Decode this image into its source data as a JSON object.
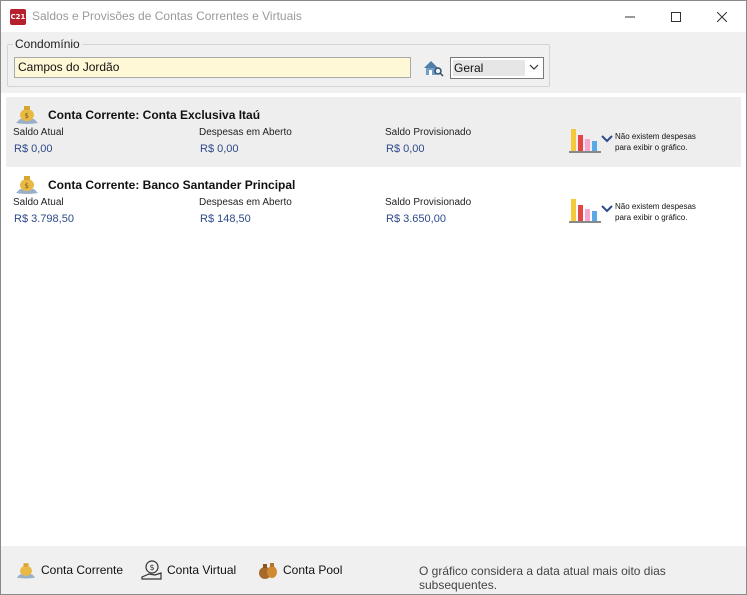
{
  "window": {
    "title": "Saldos e Provisões de Contas Correntes e Virtuais",
    "app_icon_text": "C21"
  },
  "filter": {
    "group_label": "Condomínio",
    "condominio_value": "Campos do Jordão",
    "select_value": "Geral"
  },
  "columns": {
    "saldo_atual": "Saldo Atual",
    "despesas": "Despesas em Aberto",
    "saldo_provisionado": "Saldo Provisionado"
  },
  "accounts": [
    {
      "title": "Conta Corrente: Conta Exclusiva Itaú",
      "saldo_atual": "R$ 0,00",
      "despesas": "R$ 0,00",
      "saldo_provisionado": "R$ 0,00",
      "chart_note_line1": "Não existem despesas",
      "chart_note_line2": "para exibir o gráfico."
    },
    {
      "title": "Conta Corrente: Banco Santander Principal",
      "saldo_atual": "R$ 3.798,50",
      "despesas": "R$ 148,50",
      "saldo_provisionado": "R$ 3.650,00",
      "chart_note_line1": "Não existem despesas",
      "chart_note_line2": "para exibir o gráfico."
    }
  ],
  "footer": {
    "conta_corrente": "Conta Corrente",
    "conta_virtual": "Conta Virtual",
    "conta_pool": "Conta Pool",
    "note": "O gráfico considera a data atual mais oito dias subsequentes."
  },
  "colors": {
    "value_text": "#2e4a8a",
    "input_bg": "#fff8d6",
    "card_shade": "#eeeeee"
  }
}
